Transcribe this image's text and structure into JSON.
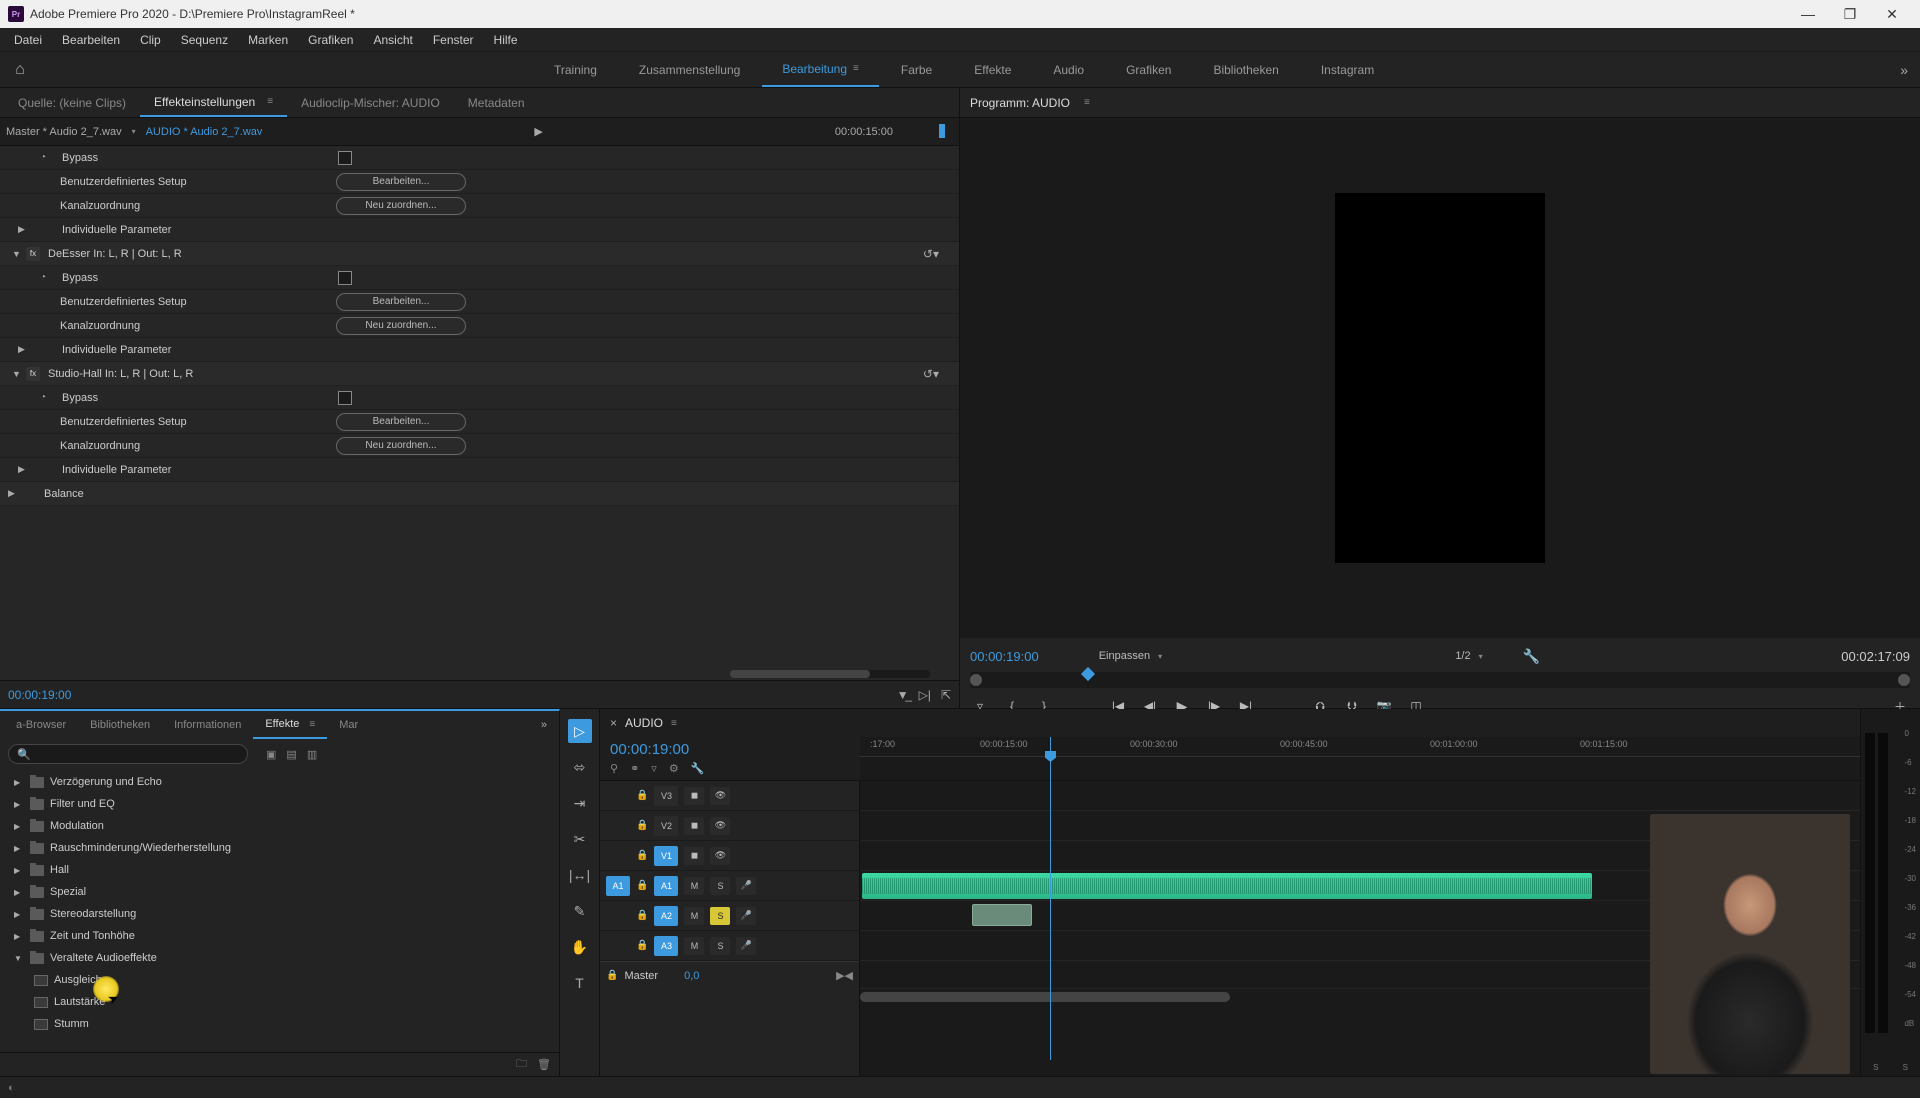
{
  "title": "Adobe Premiere Pro 2020 - D:\\Premiere Pro\\InstagramReel *",
  "menu": [
    "Datei",
    "Bearbeiten",
    "Clip",
    "Sequenz",
    "Marken",
    "Grafiken",
    "Ansicht",
    "Fenster",
    "Hilfe"
  ],
  "workspaces": [
    "Training",
    "Zusammenstellung",
    "Bearbeitung",
    "Farbe",
    "Effekte",
    "Audio",
    "Grafiken",
    "Bibliotheken",
    "Instagram"
  ],
  "workspace_active": "Bearbeitung",
  "source_panel": {
    "tabs": [
      "Quelle: (keine Clips)",
      "Effekteinstellungen",
      "Audioclip-Mischer: AUDIO",
      "Metadaten"
    ],
    "active_tab": "Effekteinstellungen",
    "master": "Master * Audio 2_7.wav",
    "clip": "AUDIO * Audio 2_7.wav",
    "header_time": "00:00:15:00",
    "footer_time": "00:00:19:00",
    "rows": {
      "bypass": "Bypass",
      "custom_setup": "Benutzerdefiniertes Setup",
      "channel_map": "Kanalzuordnung",
      "individual": "Individuelle Parameter",
      "deesser": "DeEsser In: L, R | Out: L, R",
      "studio": "Studio-Hall In: L, R | Out: L, R",
      "balance": "Balance",
      "edit_btn": "Bearbeiten...",
      "remap_btn": "Neu zuordnen..."
    }
  },
  "program": {
    "title": "Programm: AUDIO",
    "time_current": "00:00:19:00",
    "fit": "Einpassen",
    "resolution": "1/2",
    "time_total": "00:02:17:09"
  },
  "browser": {
    "tabs": [
      "a-Browser",
      "Bibliotheken",
      "Informationen",
      "Effekte",
      "Mar"
    ],
    "active_tab": "Effekte",
    "folders": [
      "Verzögerung und Echo",
      "Filter und EQ",
      "Modulation",
      "Rauschminderung/Wiederherstellung",
      "Hall",
      "Spezial",
      "Stereodarstellung",
      "Zeit und Tonhöhe",
      "Veraltete Audioeffekte"
    ],
    "items": [
      "Ausgleich",
      "Lautstärke",
      "Stumm"
    ]
  },
  "timeline": {
    "name": "AUDIO",
    "time": "00:00:19:00",
    "ruler": [
      ":17:00",
      "00:00:15:00",
      "00:00:30:00",
      "00:00:45:00",
      "00:01:00:00",
      "00:01:15:00"
    ],
    "video_tracks": [
      "V3",
      "V2",
      "V1"
    ],
    "audio_tracks": [
      "A1",
      "A2",
      "A3"
    ],
    "master": "Master",
    "master_val": "0,0",
    "mute": "M",
    "solo": "S",
    "source_a1": "A1"
  },
  "meters": {
    "marks": [
      "0",
      "-6",
      "-12",
      "-18",
      "-24",
      "-30",
      "-36",
      "-42",
      "-48",
      "-54",
      "dB"
    ],
    "channels": [
      "S",
      "S"
    ]
  }
}
